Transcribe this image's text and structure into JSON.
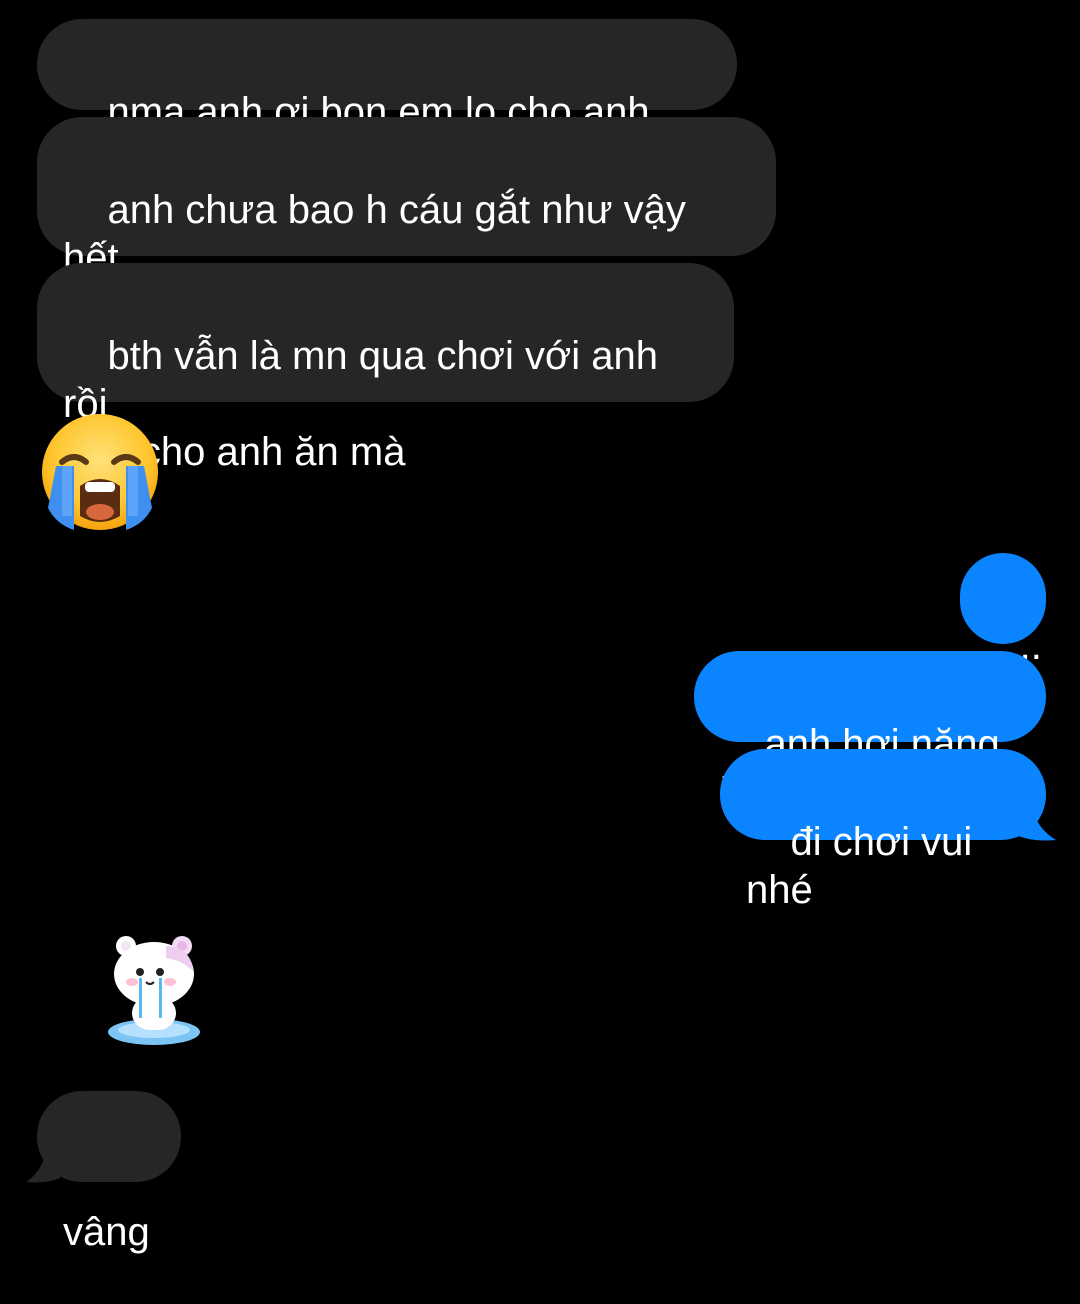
{
  "messages": {
    "received_1": "nma anh ơi bọn em lo cho anh lắm",
    "received_2": "anh chưa bao h cáu gắt như vậy hết\ná..",
    "received_3": "bth vẫn là mn qua chơi với anh rồi\nnấu cho anh ăn mà",
    "sent_1": "...",
    "sent_2": "anh hơi nặng lời",
    "sent_3": "đi chơi vui nhé",
    "received_4": "vâng"
  },
  "emoji": {
    "icon": "loudly-crying-face-emoji"
  },
  "sticker": {
    "icon": "crying-bear-sticker"
  },
  "colors": {
    "background": "#000000",
    "incoming_bubble": "#262628",
    "outgoing_bubble": "#0a84ff",
    "text": "#ffffff"
  }
}
